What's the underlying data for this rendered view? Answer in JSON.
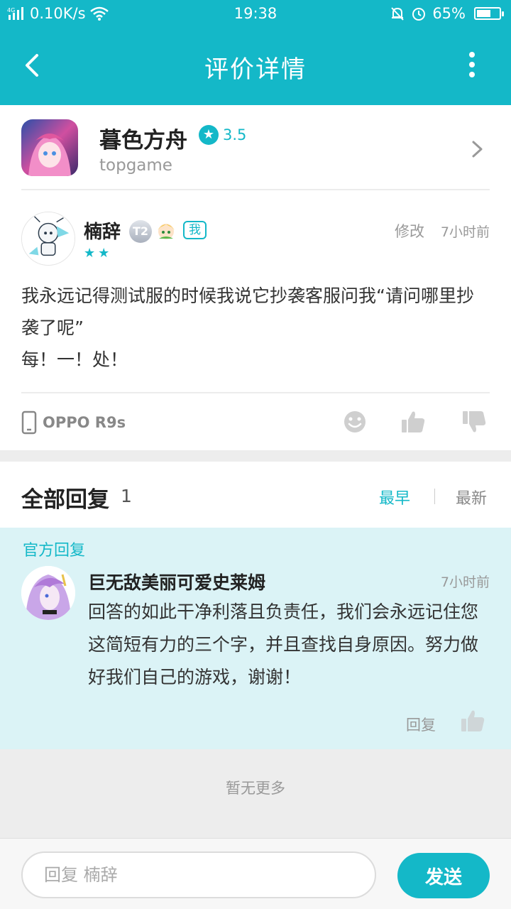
{
  "status_bar": {
    "network": "4G",
    "speed": "0.10K/s",
    "time": "19:38",
    "battery": "65%",
    "battery_level": 0.65
  },
  "header": {
    "title": "评价详情"
  },
  "app": {
    "name": "暮色方舟",
    "rating": "3.5",
    "developer": "topgame"
  },
  "review": {
    "user": "楠辞",
    "level_badge": "T2",
    "me_badge": "我",
    "stars": "★★",
    "edit_label": "修改",
    "time": "7小时前",
    "body_line1": "我永远记得测试服的时候我说它抄袭客服问我“请问哪里抄袭了呢”",
    "body_line2": "每！一！处！",
    "device": "OPPO R9s"
  },
  "replies": {
    "title": "全部回复",
    "count": "1",
    "sort_earliest": "最早",
    "sort_newest": "最新",
    "official": {
      "label": "官方回复",
      "name": "巨无敌美丽可爱史莱姆",
      "time": "7小时前",
      "body": "回答的如此干净利落且负责任，我们会永远记住您这简短有力的三个字，并且查找自身原因。努力做好我们自己的游戏，谢谢！",
      "reply_label": "回复"
    },
    "no_more": "暂无更多"
  },
  "bottom_bar": {
    "input_placeholder": "回复 楠辞",
    "send_label": "发送"
  },
  "colors": {
    "accent": "#14b8c8",
    "official_bg": "#dbf3f6"
  }
}
